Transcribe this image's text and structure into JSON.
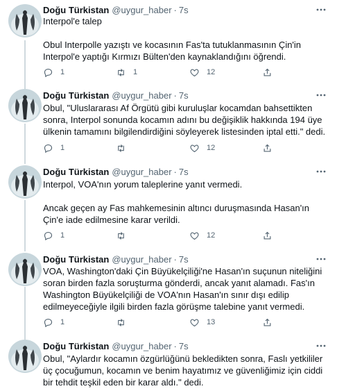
{
  "tweets": [
    {
      "name": "Doğu Türkistan",
      "handle": "@uygur_haber",
      "time": "7s",
      "paragraphs": [
        "Interpol'e talep",
        "Obul Interpolle yazıştı ve kocasının Fas'ta tutuklanmasının Çin'in Interpol'e yaptığı Kırmızı Bülten'den kaynaklandığını öğrendi."
      ],
      "replies": "1",
      "retweets": "1",
      "likes": "12"
    },
    {
      "name": "Doğu Türkistan",
      "handle": "@uygur_haber",
      "time": "7s",
      "paragraphs": [
        "Obul, \"Uluslararası Af Örgütü gibi kuruluşlar kocamdan bahsettikten sonra, Interpol sonunda kocamın adını bu değişiklik hakkında 194 üye ülkenin tamamını bilgilendirdiğini söyleyerek listesinden iptal etti.\" dedi."
      ],
      "replies": "1",
      "retweets": "",
      "likes": "12"
    },
    {
      "name": "Doğu Türkistan",
      "handle": "@uygur_haber",
      "time": "7s",
      "paragraphs": [
        "Interpol, VOA'nın yorum taleplerine yanıt vermedi.",
        "Ancak geçen ay Fas mahkemesinin altıncı duruşmasında Hasan'ın Çin'e iade edilmesine karar verildi."
      ],
      "replies": "1",
      "retweets": "",
      "likes": "12"
    },
    {
      "name": "Doğu Türkistan",
      "handle": "@uygur_haber",
      "time": "7s",
      "paragraphs": [
        "VOA, Washington'daki Çin Büyükelçiliği'ne Hasan'ın suçunun niteliğini soran birden fazla soruşturma gönderdi, ancak yanıt alamadı. Fas'ın Washington Büyükelçiliği de VOA'nın Hasan'ın sınır dışı edilip edilmeyeceğiyle ilgili birden fazla görüşme talebine yanıt vermedi."
      ],
      "replies": "1",
      "retweets": "",
      "likes": "13"
    },
    {
      "name": "Doğu Türkistan",
      "handle": "@uygur_haber",
      "time": "7s",
      "paragraphs": [
        "Obul, \"Aylardır kocamın özgürlüğünü bekledikten sonra, Faslı yetkililer üç çocuğumun, kocamın ve benim hayatımız ve güvenliğimiz için ciddi bir tehdit teşkil eden bir karar aldı.\" dedi."
      ],
      "replies": "",
      "retweets": "",
      "likes": ""
    }
  ],
  "icons": {
    "avatar": "figure-avatar-icon",
    "more": "more-icon",
    "reply": "reply-icon",
    "retweet": "retweet-icon",
    "like": "heart-icon",
    "share": "share-icon"
  },
  "colors": {
    "text": "#0f1419",
    "muted": "#536471",
    "divider": "#eff3f4",
    "thread_line": "#cfd9de",
    "avatar_bg": "#c7d6dc"
  }
}
